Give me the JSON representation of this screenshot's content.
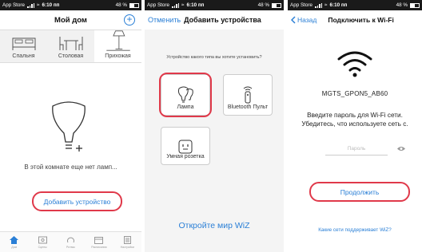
{
  "statusbar": {
    "carrier": "App Store",
    "time": "6:10 пп",
    "battery": "48 %"
  },
  "screen1": {
    "title": "Мой дом",
    "add_icon": "plus-circle-icon",
    "rooms": [
      {
        "label": "Спальня",
        "icon": "bed-icon"
      },
      {
        "label": "Столовая",
        "icon": "dining-table-icon"
      },
      {
        "label": "Прихожая",
        "icon": "floor-lamp-icon"
      }
    ],
    "empty_text": "В этой комнате еще нет ламп...",
    "add_device_label": "Добавить устройство",
    "tabs": [
      {
        "label": "Дом",
        "icon": "home-icon"
      },
      {
        "label": "Сцены",
        "icon": "scenes-icon"
      },
      {
        "label": "Ритмы",
        "icon": "rhythm-icon"
      },
      {
        "label": "Расписания",
        "icon": "schedule-icon"
      },
      {
        "label": "Настройки",
        "icon": "settings-icon"
      }
    ]
  },
  "screen2": {
    "cancel_label": "Отменить",
    "title": "Добавить устройства",
    "question": "Устройство какого типа вы хотите установить?",
    "devices": [
      {
        "label": "Лампа",
        "icon": "bulb-icon"
      },
      {
        "label": "Bluetooth Пульт",
        "icon": "remote-icon"
      },
      {
        "label": "Умная розетка",
        "icon": "smart-plug-icon"
      }
    ],
    "explore_label": "Откройте мир WiZ"
  },
  "screen3": {
    "back_label": "Назад",
    "title": "Подключить к Wi-Fi",
    "network_name": "MGTS_GPON5_AB60",
    "instruction_line1": "Введите пароль для Wi-Fi сети.",
    "instruction_line2": "Убедитесь, что используете сеть с.",
    "password_placeholder": "Пароль",
    "continue_label": "Продолжить",
    "support_link": "Какие сети поддерживает WiZ?"
  },
  "colors": {
    "accent": "#2a7fd6",
    "highlight": "#e0394a"
  }
}
